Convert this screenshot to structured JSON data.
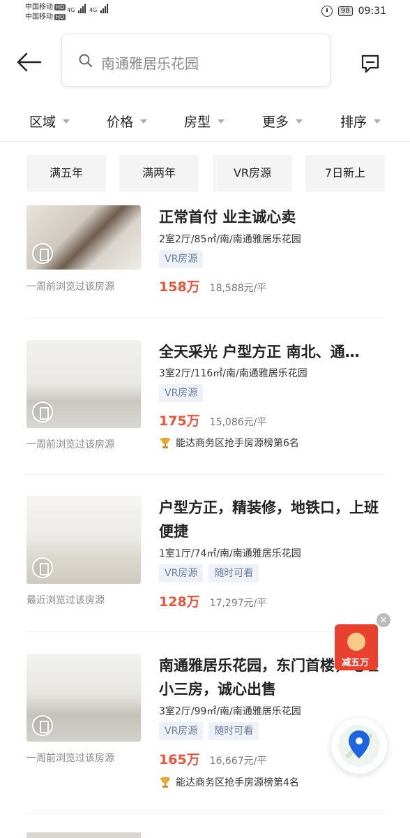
{
  "status": {
    "carrier1": "中国移动",
    "carrier2": "中国移动",
    "hd": "HD",
    "net1": "4G",
    "net2": "4G",
    "battery": "98",
    "time": "09:31"
  },
  "header": {
    "search_text": "南通雅居乐花园"
  },
  "filters": [
    "区域",
    "价格",
    "房型",
    "更多",
    "排序"
  ],
  "quick_tags": [
    "满五年",
    "满两年",
    "VR房源",
    "7日新上"
  ],
  "listings": [
    {
      "title": "正常首付 业主诚心卖",
      "info": "2室2厅/85㎡/南/南通雅居乐花园",
      "badges": [
        "VR房源"
      ],
      "price": "158万",
      "unit_price": "18,588元/平",
      "viewed": "一周前浏览过该房源",
      "rank": ""
    },
    {
      "title": "全天采光 户型方正 南北、通…",
      "info": "3室2厅/116㎡/南/南通雅居乐花园",
      "badges": [
        "VR房源"
      ],
      "price": "175万",
      "unit_price": "15,086元/平",
      "viewed": "一周前浏览过该房源",
      "rank": "能达商务区抢手房源榜第6名"
    },
    {
      "title": "户型方正，精装修，地铁口，上班便捷",
      "info": "1室1厅/74㎡/南/南通雅居乐花园",
      "badges": [
        "VR房源",
        "随时可看"
      ],
      "price": "128万",
      "unit_price": "17,297元/平",
      "viewed": "最近浏览过该房源",
      "rank": ""
    },
    {
      "title": "南通雅居乐花园，东门首楼，毛坯小三房，诚心出售",
      "info": "3室2厅/99㎡/南/南通雅居乐花园",
      "badges": [
        "VR房源",
        "随时可看"
      ],
      "price": "165万",
      "unit_price": "16,667元/平",
      "viewed": "一周前浏览过该房源",
      "rank": "能达商务区抢手房源榜第4名"
    }
  ],
  "promo": {
    "text": "减五万",
    "close": "×"
  },
  "colors": {
    "price": "#e8533a",
    "badge_bg": "#eef2f8",
    "badge_text": "#6b7f98",
    "map_pin": "#1e63e0"
  }
}
